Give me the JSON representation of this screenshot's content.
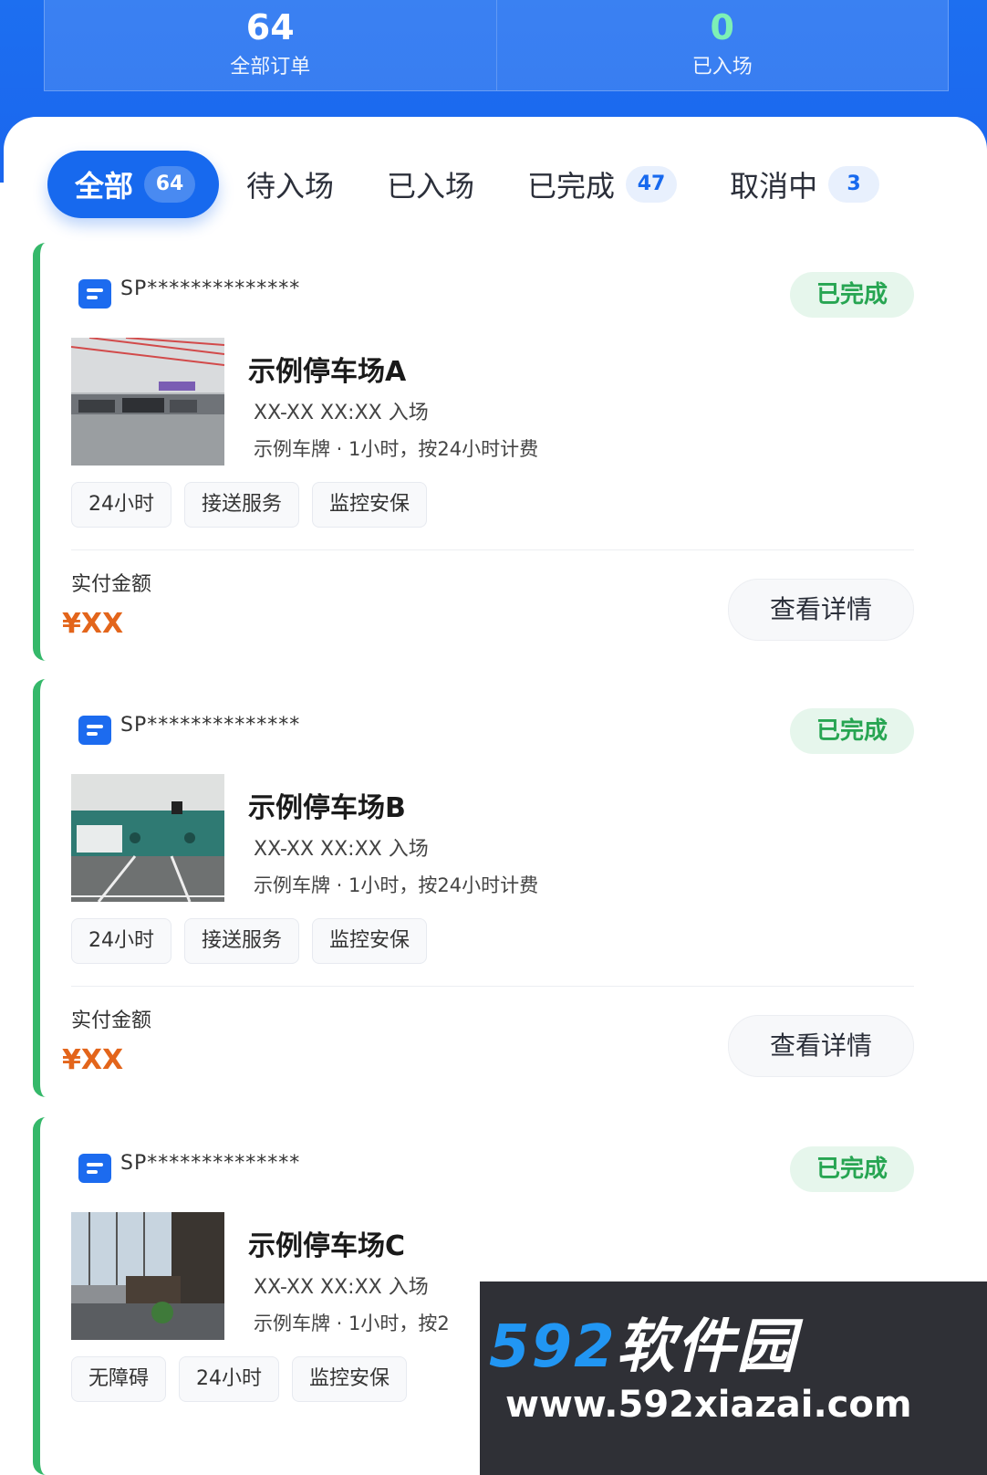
{
  "stats": [
    {
      "value": "64",
      "label": "全部订单"
    },
    {
      "value": "0",
      "label": "已入场"
    }
  ],
  "tabs": [
    {
      "label": "全部",
      "count": "64"
    },
    {
      "label": "待入场",
      "count": ""
    },
    {
      "label": "已入场",
      "count": ""
    },
    {
      "label": "已完成",
      "count": "47"
    },
    {
      "label": "取消中",
      "count": "3"
    }
  ],
  "orders": [
    {
      "id": "SP**************",
      "status": "已完成",
      "name": "示例停车场A",
      "entry": "XX-XX XX:XX 入场",
      "plate_info": "示例车牌 · 1小时，按24小时计费",
      "tags": [
        "24小时",
        "接送服务",
        "监控安保"
      ],
      "paid_label": "实付金额",
      "price": "¥XX",
      "action": "查看详情"
    },
    {
      "id": "SP**************",
      "status": "已完成",
      "name": "示例停车场B",
      "entry": "XX-XX XX:XX 入场",
      "plate_info": "示例车牌 · 1小时，按24小时计费",
      "tags": [
        "24小时",
        "接送服务",
        "监控安保"
      ],
      "paid_label": "实付金额",
      "price": "¥XX",
      "action": "查看详情"
    },
    {
      "id": "SP**************",
      "status": "已完成",
      "name": "示例停车场C",
      "entry": "XX-XX XX:XX 入场",
      "plate_info": "示例车牌 · 1小时，按2",
      "tags": [
        "无障碍",
        "24小时",
        "监控安保"
      ]
    }
  ],
  "watermark": {
    "logo_num": "592",
    "logo_text": "软件园",
    "url": "www.592xiazai.com"
  },
  "colors": {
    "brand_blue": "#1769ee",
    "success_green": "#27a552",
    "price_orange": "#e3651b"
  }
}
